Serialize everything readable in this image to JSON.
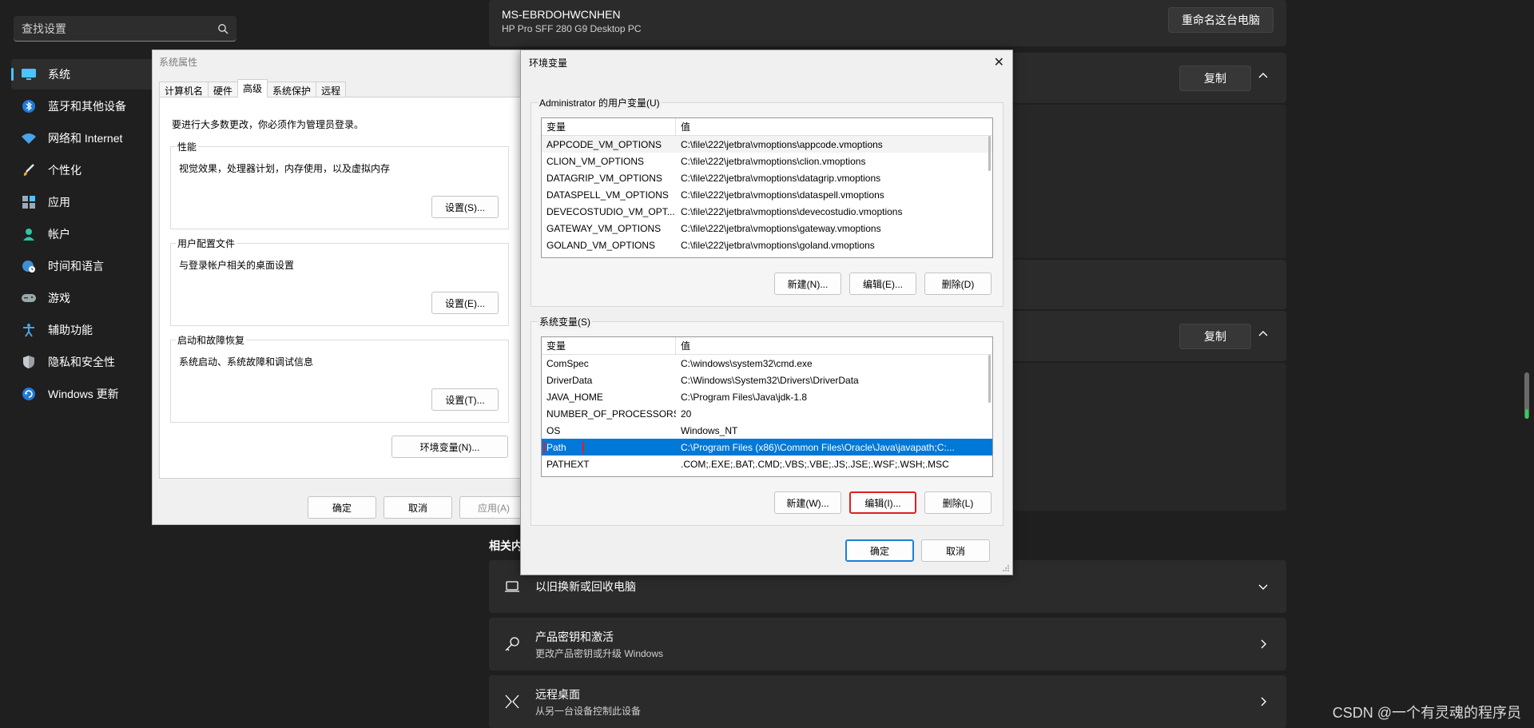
{
  "settings": {
    "search_placeholder": "查找设置",
    "nav": [
      {
        "label": "系统",
        "icon": "monitor-icon",
        "active": true
      },
      {
        "label": "蓝牙和其他设备",
        "icon": "bluetooth-icon"
      },
      {
        "label": "网络和 Internet",
        "icon": "wifi-icon"
      },
      {
        "label": "个性化",
        "icon": "brush-icon"
      },
      {
        "label": "应用",
        "icon": "apps-icon"
      },
      {
        "label": "帐户",
        "icon": "person-icon"
      },
      {
        "label": "时间和语言",
        "icon": "globe-clock-icon"
      },
      {
        "label": "游戏",
        "icon": "gamepad-icon"
      },
      {
        "label": "辅助功能",
        "icon": "accessibility-icon"
      },
      {
        "label": "隐私和安全性",
        "icon": "shield-icon"
      },
      {
        "label": "Windows 更新",
        "icon": "update-icon"
      }
    ],
    "device_name": "MS-EBRDOHWCNHEN",
    "device_model": "HP Pro SFF 280 G9 Desktop PC",
    "rename_label": "重命名这台电脑",
    "copy_label_1": "复制",
    "copy_label_2": "复制",
    "related_label": "相关内",
    "related": [
      {
        "title": "以旧换新或回收电脑",
        "subtitle": "",
        "icon": "laptop-icon"
      },
      {
        "title": "产品密钥和激活",
        "subtitle": "更改产品密钥或升级 Windows",
        "icon": "key-icon"
      },
      {
        "title": "远程桌面",
        "subtitle": "从另一台设备控制此设备",
        "icon": "remote-desktop-icon"
      }
    ],
    "watermark": "CSDN @一个有灵魂的程序员"
  },
  "sysprops": {
    "title": "系统属性",
    "tabs": [
      "计算机名",
      "硬件",
      "高级",
      "系统保护",
      "远程"
    ],
    "active_tab": "高级",
    "note": "要进行大多数更改，你必须作为管理员登录。",
    "perf_title": "性能",
    "perf_text": "视觉效果，处理器计划，内存使用，以及虚拟内存",
    "perf_btn": "设置(S)...",
    "profile_title": "用户配置文件",
    "profile_text": "与登录帐户相关的桌面设置",
    "profile_btn": "设置(E)...",
    "startup_title": "启动和故障恢复",
    "startup_text": "系统启动、系统故障和调试信息",
    "startup_btn": "设置(T)...",
    "env_btn": "环境变量(N)...",
    "ok": "确定",
    "cancel": "取消",
    "apply": "应用(A)"
  },
  "envdlg": {
    "title": "环境变量",
    "user_group": "Administrator 的用户变量(U)",
    "col_var": "变量",
    "col_val": "值",
    "user_vars": [
      {
        "name": "APPCODE_VM_OPTIONS",
        "value": "C:\\file\\222\\jetbra\\vmoptions\\appcode.vmoptions"
      },
      {
        "name": "CLION_VM_OPTIONS",
        "value": "C:\\file\\222\\jetbra\\vmoptions\\clion.vmoptions"
      },
      {
        "name": "DATAGRIP_VM_OPTIONS",
        "value": "C:\\file\\222\\jetbra\\vmoptions\\datagrip.vmoptions"
      },
      {
        "name": "DATASPELL_VM_OPTIONS",
        "value": "C:\\file\\222\\jetbra\\vmoptions\\dataspell.vmoptions"
      },
      {
        "name": "DEVECOSTUDIO_VM_OPT...",
        "value": "C:\\file\\222\\jetbra\\vmoptions\\devecostudio.vmoptions"
      },
      {
        "name": "GATEWAY_VM_OPTIONS",
        "value": "C:\\file\\222\\jetbra\\vmoptions\\gateway.vmoptions"
      },
      {
        "name": "GOLAND_VM_OPTIONS",
        "value": "C:\\file\\222\\jetbra\\vmoptions\\goland.vmoptions"
      }
    ],
    "user_new": "新建(N)...",
    "user_edit": "编辑(E)...",
    "user_delete": "删除(D)",
    "sys_group": "系统变量(S)",
    "sys_vars": [
      {
        "name": "ComSpec",
        "value": "C:\\windows\\system32\\cmd.exe"
      },
      {
        "name": "DriverData",
        "value": "C:\\Windows\\System32\\Drivers\\DriverData"
      },
      {
        "name": "JAVA_HOME",
        "value": "C:\\Program Files\\Java\\jdk-1.8"
      },
      {
        "name": "NUMBER_OF_PROCESSORS",
        "value": "20"
      },
      {
        "name": "OS",
        "value": "Windows_NT"
      },
      {
        "name": "Path",
        "value": "C:\\Program Files (x86)\\Common Files\\Oracle\\Java\\javapath;C:..."
      },
      {
        "name": "PATHEXT",
        "value": ".COM;.EXE;.BAT;.CMD;.VBS;.VBE;.JS;.JSE;.WSF;.WSH;.MSC"
      }
    ],
    "selected_sys_var": "Path",
    "sys_new": "新建(W)...",
    "sys_edit": "编辑(I)...",
    "sys_delete": "删除(L)",
    "ok": "确定",
    "cancel": "取消"
  }
}
